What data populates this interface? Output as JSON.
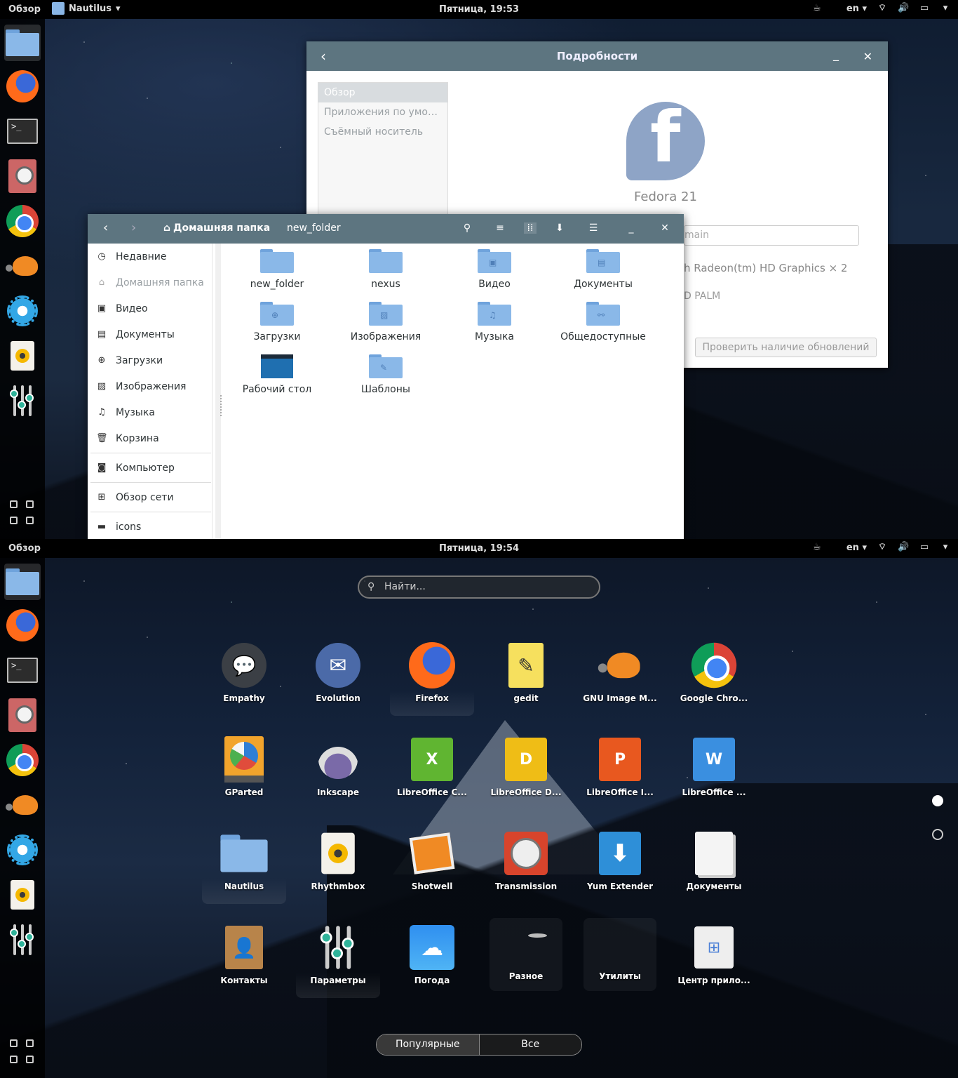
{
  "top_screen": {
    "topbar": {
      "overview": "Обзор",
      "app_menu": "Nautilus",
      "clock": "Пятница, 19:53",
      "lang": "en"
    },
    "details_window": {
      "title": "Подробности",
      "sidebar": [
        "Обзор",
        "Приложения по умолчанию",
        "Съёмный носитель"
      ],
      "os_name": "Fedora 21",
      "device_name_field": "main",
      "graphics": "h Radeon(tm) HD Graphics × 2",
      "os_line": "D PALM",
      "update_button": "Проверить наличие обновлений"
    },
    "nautilus": {
      "crumb_home": "Домашняя папка",
      "crumb_current": "new_folder",
      "sidebar": [
        {
          "label": "Недавние",
          "icon": "clock-icon"
        },
        {
          "label": "Домашняя папка",
          "icon": "home-icon"
        },
        {
          "label": "Видео",
          "icon": "film-icon"
        },
        {
          "label": "Документы",
          "icon": "document-icon"
        },
        {
          "label": "Загрузки",
          "icon": "download-icon"
        },
        {
          "label": "Изображения",
          "icon": "image-icon"
        },
        {
          "label": "Музыка",
          "icon": "music-icon"
        },
        {
          "label": "Корзина",
          "icon": "trash-icon"
        },
        {
          "label": "Компьютер",
          "icon": "computer-icon"
        },
        {
          "label": "Обзор сети",
          "icon": "network-icon"
        },
        {
          "label": "icons",
          "icon": "folder-icon"
        }
      ],
      "files": [
        "new_folder",
        "nexus",
        "Видео",
        "Документы",
        "Загрузки",
        "Изображения",
        "Музыка",
        "Общедоступные",
        "Рабочий стол",
        "Шаблоны"
      ]
    }
  },
  "bottom_screen": {
    "topbar": {
      "overview": "Обзор",
      "clock": "Пятница, 19:54",
      "lang": "en"
    },
    "search_placeholder": "Найти...",
    "apps": [
      "Empathy",
      "Evolution",
      "Firefox",
      "gedit",
      "GNU Image M...",
      "Google Chro...",
      "GParted",
      "Inkscape",
      "LibreOffice C...",
      "LibreOffice D...",
      "LibreOffice I...",
      "LibreOffice ...",
      "Nautilus",
      "Rhythmbox",
      "Shotwell",
      "Transmission",
      "Yum Extender",
      "Документы",
      "Контакты",
      "Параметры",
      "Погода",
      "Разное",
      "Утилиты",
      "Центр прило..."
    ],
    "switch": {
      "frequent": "Популярные",
      "all": "Все"
    }
  }
}
